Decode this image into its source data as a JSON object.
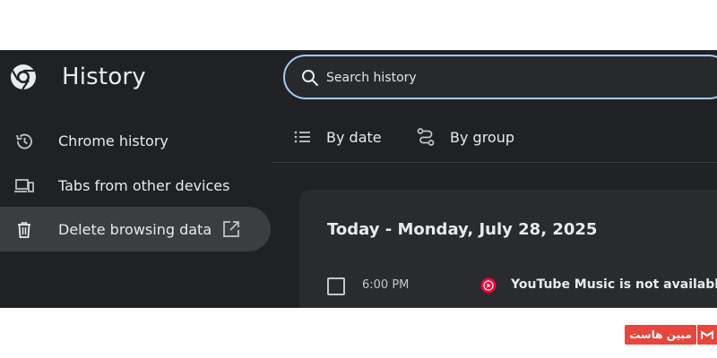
{
  "header": {
    "title": "History",
    "search": {
      "placeholder": "Search history",
      "value": ""
    }
  },
  "sidebar": {
    "items": [
      {
        "label": "Chrome history",
        "icon": "history-icon"
      },
      {
        "label": "Tabs from other devices",
        "icon": "devices-icon"
      },
      {
        "label": "Delete browsing data",
        "icon": "trash-icon",
        "trailing_icon": "open-in-new-icon"
      }
    ]
  },
  "tabs": [
    {
      "label": "By date",
      "icon": "list-icon",
      "selected": true
    },
    {
      "label": "By group",
      "icon": "journeys-icon",
      "selected": false
    }
  ],
  "history": {
    "date_heading": "Today - Monday, July 28, 2025",
    "entries": [
      {
        "time": "6:00 PM",
        "title": "YouTube Music is not available in y",
        "favicon": "youtube-music-icon"
      }
    ]
  },
  "watermark": {
    "text": "مبین هاست"
  },
  "colors": {
    "background": "#202124",
    "search_border": "#a8c7fa",
    "active_nav": "#3c3d40",
    "watermark": "#e8453c"
  }
}
